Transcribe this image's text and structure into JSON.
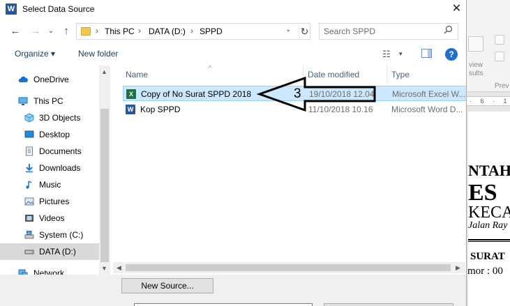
{
  "window": {
    "title": "Select Data Source",
    "app_icon_letter": "W",
    "close_glyph": "✕"
  },
  "navigation": {
    "back": "←",
    "forward": "→",
    "recent": "⌄",
    "up": "↑",
    "breadcrumbs": [
      "This PC",
      "DATA (D:)",
      "SPPD"
    ],
    "separator": "›",
    "dropdown": "⌄",
    "refresh": "↻"
  },
  "search": {
    "placeholder": "Search SPPD",
    "icon": "search-icon"
  },
  "toolbar": {
    "organize_label": "Organize ▾",
    "new_folder_label": "New folder",
    "views_glyph": "☷",
    "views_dropdown": "▾",
    "help_glyph": "?"
  },
  "nav_pane": {
    "items": [
      {
        "label": "OneDrive",
        "icon": "cloud-icon"
      },
      {
        "label": "This PC",
        "icon": "computer-icon"
      },
      {
        "label": "3D Objects",
        "icon": "cube-icon"
      },
      {
        "label": "Desktop",
        "icon": "desktop-icon"
      },
      {
        "label": "Documents",
        "icon": "document-icon"
      },
      {
        "label": "Downloads",
        "icon": "download-icon"
      },
      {
        "label": "Music",
        "icon": "music-icon"
      },
      {
        "label": "Pictures",
        "icon": "picture-icon"
      },
      {
        "label": "Videos",
        "icon": "video-icon"
      },
      {
        "label": "System (C:)",
        "icon": "drive-icon"
      },
      {
        "label": "DATA (D:)",
        "icon": "drive-icon",
        "selected": true
      },
      {
        "label": "Network",
        "icon": "network-icon"
      }
    ]
  },
  "file_list": {
    "columns": [
      "Name",
      "Date modified",
      "Type"
    ],
    "sort_glyph": "^",
    "rows": [
      {
        "name": "Copy of No Surat SPPD 2018",
        "date": "19/10/2018 12.04",
        "type": "Microsoft Excel W...",
        "icon": "excel-file-icon",
        "icon_letter": "X",
        "icon_color": "#1e7145",
        "selected": true
      },
      {
        "name": "Kop SPPD",
        "date": "11/10/2018 10.16",
        "type": "Microsoft Word D...",
        "icon": "word-file-icon",
        "icon_letter": "W",
        "icon_color": "#2b579a",
        "selected": false
      }
    ]
  },
  "annotation": {
    "number": "3"
  },
  "bottom": {
    "new_source_label": "New Source..."
  },
  "background_document": {
    "ribbon_texts": [
      "view",
      "sults",
      "Prev"
    ],
    "ruler_text": "· 6 · 1",
    "lines": [
      "NTAH",
      "ES",
      "KECA",
      "Jalan Ray",
      "SURAT",
      "mor : 00"
    ]
  },
  "colors": {
    "selection_fill": "#cce8ff",
    "selection_border": "#99d1ff",
    "help_blue": "#1f6fd1",
    "link_text": "#1e395b"
  }
}
